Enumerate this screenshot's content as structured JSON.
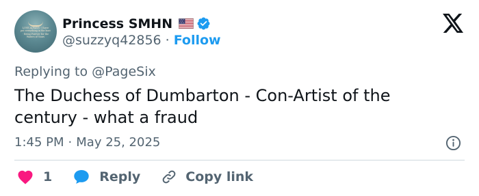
{
  "user": {
    "display_name": "Princess SMHN",
    "handle": "@suzzyq42856",
    "separator": "·",
    "follow_label": "Follow",
    "avatar_text": "LOVE ALWAYS · I have put everything in the boat · Being Forever for the Waters of Yours",
    "flag_icon": "us-flag-icon",
    "verified_color": "#1d9bf0"
  },
  "reply_context": {
    "prefix": "Replying to",
    "mention": "@PageSix"
  },
  "tweet": {
    "text": "The Duchess of Dumbarton - Con-Artist of the century - what a fraud",
    "time": "1:45 PM",
    "separator": "·",
    "date": "May 25, 2025"
  },
  "actions": {
    "like_count": "1",
    "like_color": "#f91880",
    "reply_label": "Reply",
    "reply_color": "#1d9bf0",
    "copy_label": "Copy link"
  },
  "brand_logo": "x-logo-icon"
}
